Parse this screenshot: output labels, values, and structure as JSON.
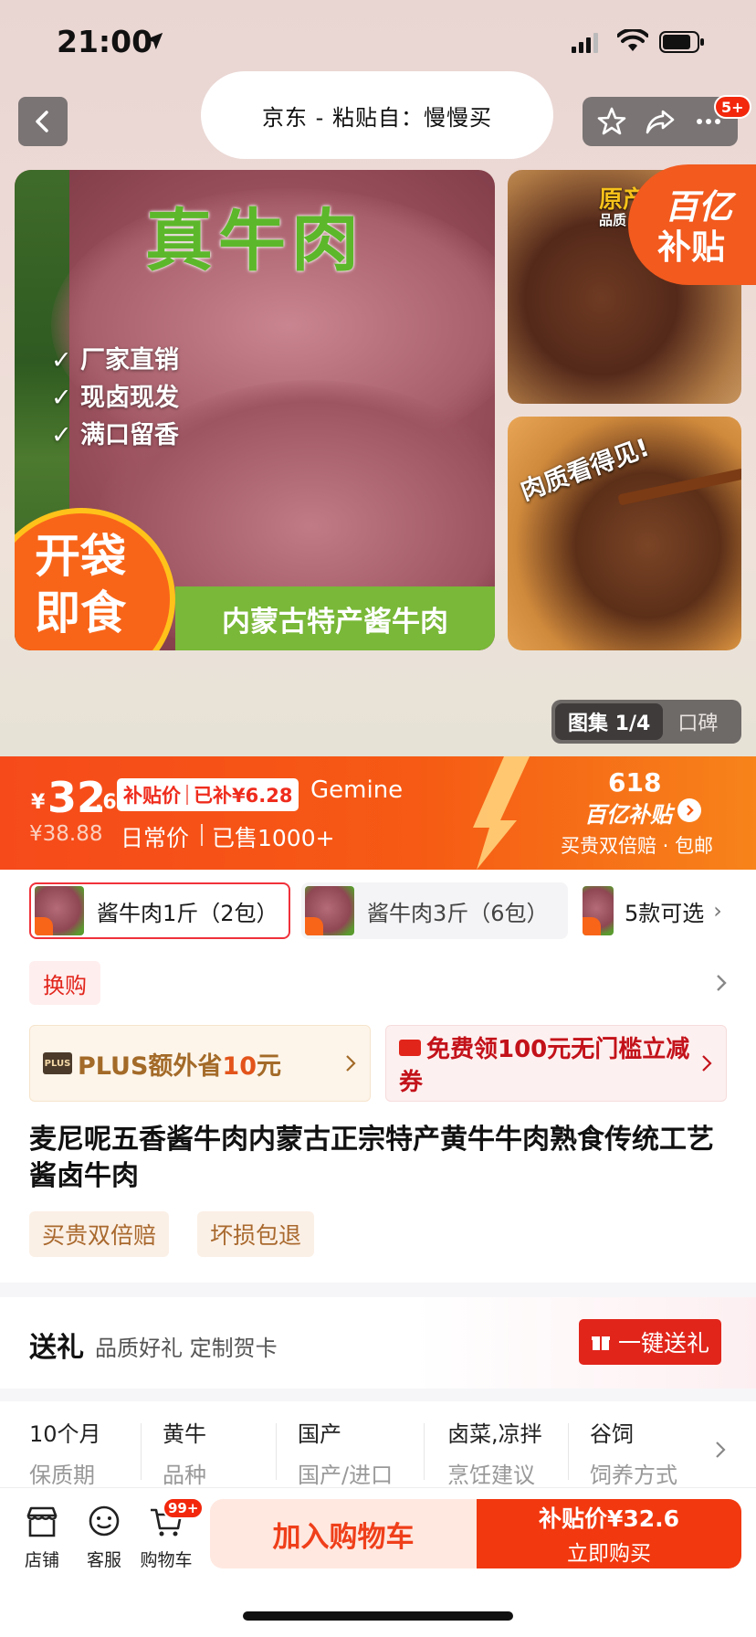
{
  "status_bar": {
    "time": "21:00"
  },
  "nav": {
    "title": "京东 - 粘贴自：慢慢买",
    "badge": "5+"
  },
  "images": {
    "main": {
      "headline": "真牛肉",
      "checks": [
        "厂家直销",
        "现卤现发",
        "满口留香"
      ],
      "corner_line1": "开袋",
      "corner_line2": "即食",
      "band": "内蒙古特产酱牛肉"
    },
    "top": {
      "origin": "原产",
      "origin_sub": "品质"
    },
    "bottom": {
      "quality": "肉质看得见!"
    },
    "subsidy_line1": "百亿",
    "subsidy_line2": "补贴"
  },
  "gallery": {
    "active": "图集 1/4",
    "other": "口碑"
  },
  "price": {
    "currency": "¥",
    "integer": "32",
    "decimal": ".6",
    "tag_label": "补贴价",
    "tag_saved": "已补¥6.28",
    "note": "Gemine",
    "old_price": "¥38.88",
    "daily_label": "日常价",
    "sold": "已售1000+",
    "event_title": "618",
    "event_sub": "百亿补贴",
    "event_desc": "买贵双倍赔 · 包邮"
  },
  "variants": [
    {
      "label": "酱牛肉1斤（2包）"
    },
    {
      "label": "酱牛肉3斤（6包）"
    },
    {
      "label": "5款可选"
    }
  ],
  "swap": {
    "label": "换购"
  },
  "plus": {
    "logo": "PLUS",
    "text_prefix": "PLUS额外省",
    "amount": "10",
    "unit": "元"
  },
  "coupon": {
    "text": "免费领100元无门槛立减券"
  },
  "product_title": "麦尼呢五香酱牛肉内蒙古正宗特产黄牛牛肉熟食传统工艺酱卤牛肉",
  "service_tags": [
    "买贵双倍赔",
    "坏损包退"
  ],
  "gift": {
    "title": "送礼",
    "subtitle": "品质好礼 定制贺卡",
    "button": "一键送礼"
  },
  "specs": [
    {
      "value": "10个月",
      "key": "保质期"
    },
    {
      "value": "黄牛",
      "key": "品种"
    },
    {
      "value": "国产",
      "key": "国产/进口"
    },
    {
      "value": "卤菜,凉拌",
      "key": "烹饪建议"
    },
    {
      "value": "谷饲",
      "key": "饲养方式"
    }
  ],
  "bottom_bar": {
    "store": "店铺",
    "service": "客服",
    "cart": "购物车",
    "cart_badge": "99+",
    "add_to_cart": "加入购物车",
    "buy_line1": "补贴价¥32.6",
    "buy_line2": "立即购买"
  },
  "colors": {
    "accent": "#f2380f",
    "subsidy_red": "#e1251b",
    "plus_gold": "#a36a28"
  }
}
